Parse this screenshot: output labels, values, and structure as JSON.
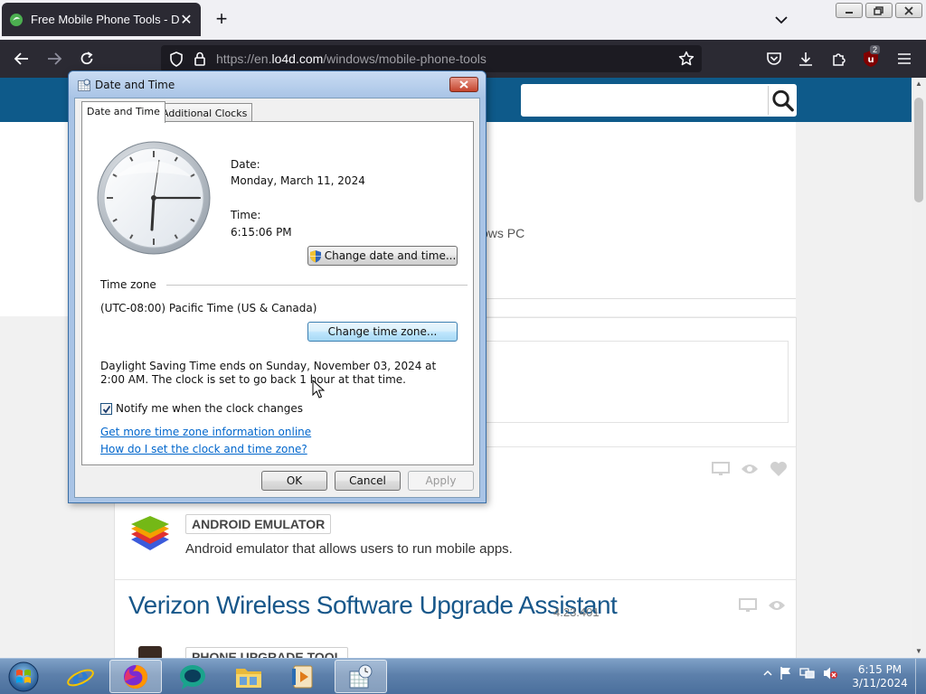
{
  "browser": {
    "tab_title": "Free Mobile Phone Tools - Dow",
    "url_prefix": "https://en.",
    "url_domain": "lo4d.com",
    "url_path": "/windows/mobile-phone-tools",
    "extension_badge": "2"
  },
  "page": {
    "subtitle_fragment": "ows PC",
    "listing": {
      "category_1": "ANDROID EMULATOR",
      "description_1": "Android emulator that allows users to run mobile apps.",
      "app_title_2": "Verizon Wireless Software Upgrade Assistant",
      "version_2": "4.23.401",
      "category_2": "PHONE UPGRADE TOOL"
    }
  },
  "dialog": {
    "title": "Date and Time",
    "tabs": [
      "Date and Time",
      "Additional Clocks"
    ],
    "date_label": "Date:",
    "date_value": "Monday, March 11, 2024",
    "time_label": "Time:",
    "time_value": "6:15:06 PM",
    "change_datetime_button": "Change date and time...",
    "timezone_heading": "Time zone",
    "timezone_value": "(UTC-08:00) Pacific Time (US & Canada)",
    "change_timezone_button": "Change time zone...",
    "dst_text": "Daylight Saving Time ends on Sunday, November 03, 2024 at 2:00 AM. The clock is set to go back 1 hour at that time.",
    "notify_checkbox_label": "Notify me when the clock changes",
    "notify_checked": true,
    "link_more_info": "Get more time zone information online",
    "link_how_to": "How do I set the clock and time zone?",
    "ok_button": "OK",
    "cancel_button": "Cancel",
    "apply_button": "Apply"
  },
  "taskbar": {
    "clock_time": "6:15 PM",
    "clock_date": "3/11/2024"
  }
}
